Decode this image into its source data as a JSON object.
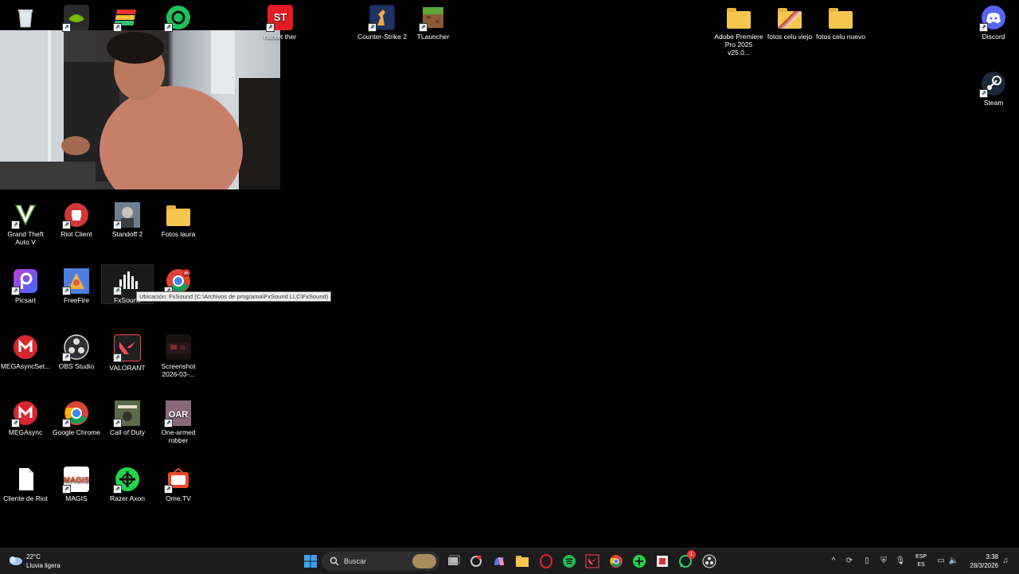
{
  "desktop": {
    "icons": [
      {
        "name": "recycle-bin",
        "label": ""
      },
      {
        "name": "nvidia-app",
        "label": ""
      },
      {
        "name": "bluestacks",
        "label": ""
      },
      {
        "name": "green-app",
        "label": ""
      },
      {
        "name": "market-tracker",
        "label": "narket ther"
      },
      {
        "name": "counter-strike-2",
        "label": "Counter-Strike 2"
      },
      {
        "name": "tlauncher",
        "label": "TLauncher"
      },
      {
        "name": "adobe-premiere",
        "label": "Adobe Premiere Pro 2025 v25.0..."
      },
      {
        "name": "fotos-celu-viejo",
        "label": "fotos celu viejo"
      },
      {
        "name": "fotos-celu-nuevo",
        "label": "fotos celu nuevo"
      },
      {
        "name": "discord",
        "label": "Discord"
      },
      {
        "name": "steam",
        "label": "Steam"
      },
      {
        "name": "gta-v",
        "label": "Grand Theft Auto V"
      },
      {
        "name": "riot-client",
        "label": "Riot Client"
      },
      {
        "name": "standoff-2",
        "label": "Standoff 2"
      },
      {
        "name": "fotos-laura",
        "label": "Fotos laura"
      },
      {
        "name": "picsart",
        "label": "Picsart"
      },
      {
        "name": "freefire",
        "label": "FreeFire"
      },
      {
        "name": "fxsound",
        "label": "FxSound"
      },
      {
        "name": "chrome-m",
        "label": ""
      },
      {
        "name": "megasync-setup",
        "label": "MEGAsyncSet..."
      },
      {
        "name": "obs-studio",
        "label": "OBS Studio"
      },
      {
        "name": "valorant",
        "label": "VALORANT"
      },
      {
        "name": "screenshot",
        "label": "Screenshot 2026-03-..."
      },
      {
        "name": "megasync",
        "label": "MEGAsync"
      },
      {
        "name": "google-chrome",
        "label": "Google Chrome"
      },
      {
        "name": "call-of-duty",
        "label": "Call of Duty"
      },
      {
        "name": "one-armed-robber",
        "label": "One-armed robber"
      },
      {
        "name": "cliente-de-riot",
        "label": "Cliente de Riot"
      },
      {
        "name": "magis",
        "label": "MAGIS"
      },
      {
        "name": "razer-axon",
        "label": "Razer Axon"
      },
      {
        "name": "ome-tv",
        "label": "Ome.TV"
      }
    ],
    "tooltip": "Ubicación: FxSound (C:\\Archivos de programa\\FxSound LLC\\FxSound)"
  },
  "taskbar": {
    "weather_temp": "22°C",
    "weather_desc": "Lluvia ligera",
    "search_placeholder": "Buscar",
    "lang_top": "ESP",
    "lang_bottom": "ES",
    "time": "3:38",
    "date": "28/3/2026",
    "whatsapp_badge": "1"
  },
  "colors": {
    "taskbar_bg": "#1c1c1c",
    "desktop_bg": "#000000",
    "accent": "#0078d4"
  }
}
